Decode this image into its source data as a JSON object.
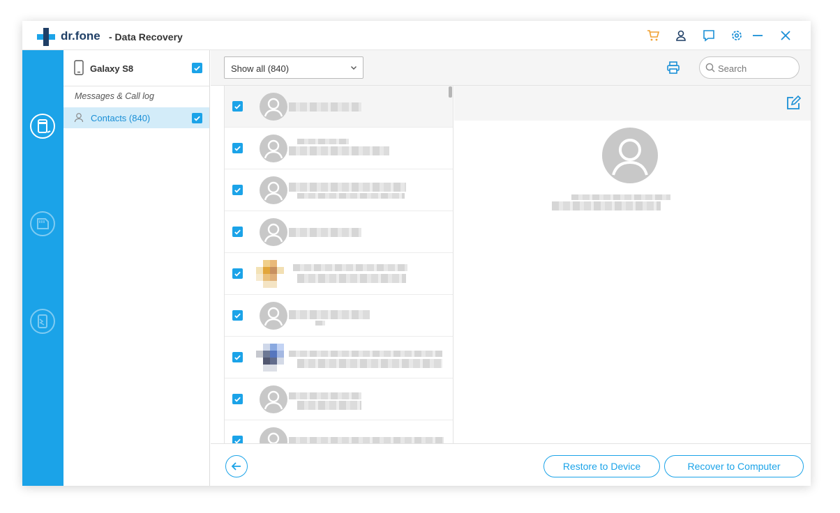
{
  "window": {
    "brand": "dr.fone",
    "title": "- Data Recovery",
    "accent_color": "#1ba3e8",
    "cart_color": "#f0a030",
    "titlebar_icons": [
      "cart-icon",
      "account-icon",
      "feedback-icon",
      "settings-icon",
      "minimize-icon",
      "close-icon"
    ]
  },
  "rail": {
    "items": [
      {
        "name": "phone-recover-icon",
        "active": true
      },
      {
        "name": "sd-card-recover-icon",
        "active": false
      },
      {
        "name": "broken-phone-recover-icon",
        "active": false
      }
    ]
  },
  "sidebar": {
    "device_name": "Galaxy S8",
    "device_checked": true,
    "section_label": "Messages & Call log",
    "contacts_label": "Contacts (840)",
    "contacts_checked": true
  },
  "toolbar": {
    "filter_value": "Show all (840)",
    "search_placeholder": "Search"
  },
  "contacts": [
    {
      "checked": true,
      "avatar": "default",
      "selected": true
    },
    {
      "checked": true,
      "avatar": "default",
      "selected": false
    },
    {
      "checked": true,
      "avatar": "default",
      "selected": false
    },
    {
      "checked": true,
      "avatar": "default",
      "selected": false
    },
    {
      "checked": true,
      "avatar": "photo-yellow",
      "selected": false
    },
    {
      "checked": true,
      "avatar": "default",
      "selected": false
    },
    {
      "checked": true,
      "avatar": "photo-blue",
      "selected": false
    },
    {
      "checked": true,
      "avatar": "default",
      "selected": false
    },
    {
      "checked": true,
      "avatar": "default",
      "selected": false
    }
  ],
  "footer": {
    "restore_label": "Restore to Device",
    "recover_label": "Recover to Computer"
  }
}
